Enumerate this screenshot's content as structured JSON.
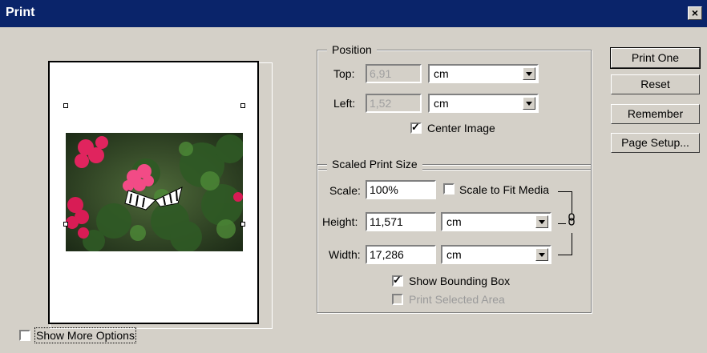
{
  "window": {
    "title": "Print",
    "close_glyph": "×"
  },
  "preview": {
    "image_alt": "butterfly on pink flowers"
  },
  "position": {
    "legend": "Position",
    "top_label": "Top:",
    "top_value": "6,91",
    "top_unit": "cm",
    "left_label": "Left:",
    "left_value": "1,52",
    "left_unit": "cm",
    "center_image_label": "Center Image",
    "center_image_checked": true
  },
  "scaled": {
    "legend": "Scaled Print Size",
    "scale_label": "Scale:",
    "scale_value": "100%",
    "fit_media_label": "Scale to Fit Media",
    "height_label": "Height:",
    "height_value": "11,571",
    "height_unit": "cm",
    "width_label": "Width:",
    "width_value": "17,286",
    "width_unit": "cm",
    "show_bbox_label": "Show Bounding Box",
    "print_selected_label": "Print Selected Area"
  },
  "buttons": {
    "print_one": "Print One",
    "reset": "Reset",
    "remember": "Remember",
    "page_setup": "Page Setup..."
  },
  "more_options_label": "Show More Options",
  "check_glyph": "✓",
  "link_icon": "chain-link-icon"
}
